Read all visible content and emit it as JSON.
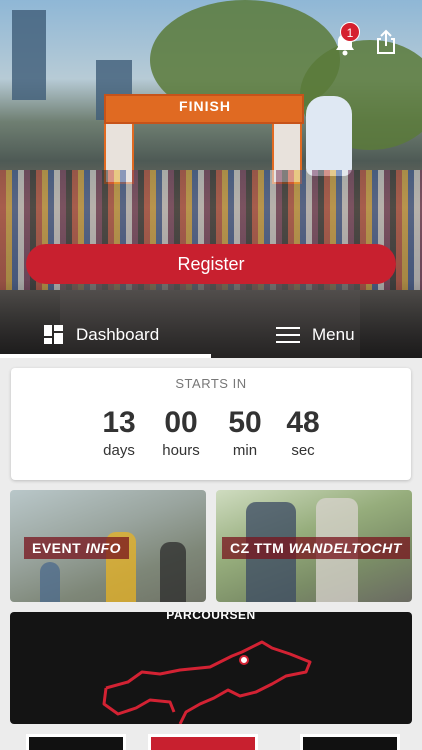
{
  "header": {
    "notification_count": "1",
    "finish_text": "FINISH"
  },
  "register_button": {
    "label": "Register"
  },
  "tabs": [
    {
      "label": "Dashboard",
      "icon": "dashboard-icon",
      "active": true
    },
    {
      "label": "Menu",
      "icon": "menu-icon",
      "active": false
    }
  ],
  "countdown": {
    "title": "STARTS IN",
    "units": [
      {
        "value": "13",
        "label": "days"
      },
      {
        "value": "00",
        "label": "hours"
      },
      {
        "value": "50",
        "label": "min"
      },
      {
        "value": "48",
        "label": "sec"
      }
    ]
  },
  "tiles": [
    {
      "label_plain": "EVENT ",
      "label_italic": "INFO"
    },
    {
      "label_plain": "CZ TTM ",
      "label_italic": "WANDELTOCHT"
    }
  ],
  "route": {
    "title": "PARCOURSEN"
  },
  "colors": {
    "accent": "#c8202f",
    "badge": "#d5202f",
    "route_line": "#d32233"
  }
}
